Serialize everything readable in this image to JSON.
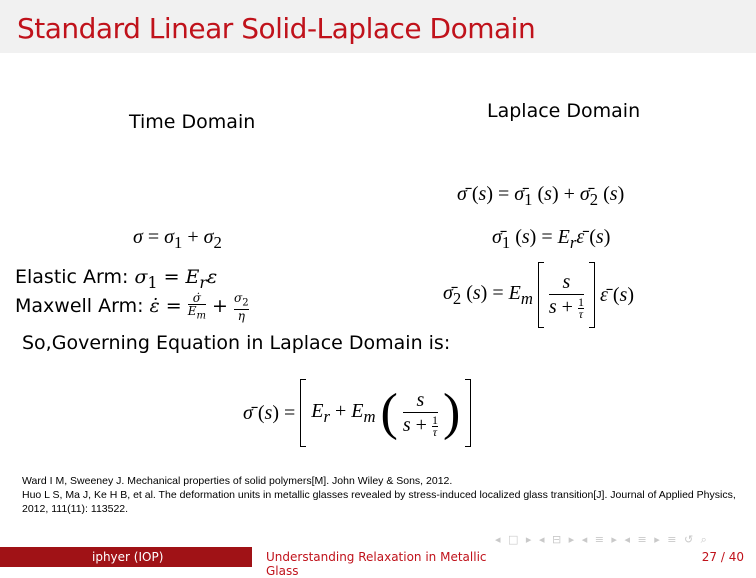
{
  "slide": {
    "title": "Standard Linear Solid-Laplace Domain",
    "time_heading": "Time Domain",
    "laplace_heading": "Laplace Domain",
    "elastic_label": "Elastic Arm:",
    "maxwell_label": "Maxwell Arm:",
    "governing_text": "So,Governing Equation in Laplace Domain is:"
  },
  "references": [
    "Ward I M, Sweeney J. Mechanical properties of solid polymers[M]. John Wiley & Sons, 2012.",
    "Huo L S, Ma J, Ke H B, et al. The deformation units in metallic glasses revealed by stress-induced localized glass transition[J]. Journal of Applied Physics, 2012, 111(11): 113522."
  ],
  "footer": {
    "author": "iphyer (IOP)",
    "talk_title": "Understanding Relaxation in Metallic Glass",
    "page": "27 / 40"
  },
  "colors": {
    "accent": "#c0121b",
    "footer_dark": "#a01216",
    "titlebar": "#f1f1f1"
  }
}
